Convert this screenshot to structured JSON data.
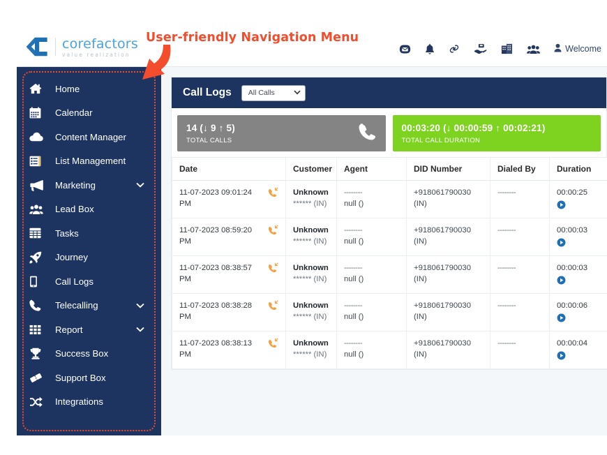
{
  "annotation": {
    "text": "User-friendly Navigation Menu",
    "color": "#f44d2e",
    "arrow_icon": "curved-arrow-icon"
  },
  "brand": {
    "logo_icon": "corefactors-logo-icon",
    "name": "corefactors",
    "tagline": "value realization",
    "name_color": "#4aa3dd"
  },
  "topbar": {
    "icons": [
      {
        "name": "message-icon",
        "glyph": "✉"
      },
      {
        "name": "bell-icon",
        "glyph": "🔔"
      },
      {
        "name": "link-icon",
        "glyph": "🔗"
      },
      {
        "name": "handshake-support-icon",
        "glyph": "✋"
      },
      {
        "name": "building-icon",
        "glyph": "🏢"
      },
      {
        "name": "users-group-icon",
        "glyph": "👥"
      }
    ],
    "user": {
      "icon": "user-icon",
      "label": "Welcome"
    }
  },
  "sidebar": {
    "background": "#1d3461",
    "highlight_border": "#f04a28",
    "items": [
      {
        "icon": "home-icon",
        "label": "Home",
        "expandable": false
      },
      {
        "icon": "calendar-icon",
        "label": "Calendar",
        "expandable": false
      },
      {
        "icon": "cloud-icon",
        "label": "Content Manager",
        "expandable": false
      },
      {
        "icon": "list-icon",
        "label": "List Management",
        "expandable": false
      },
      {
        "icon": "megaphone-icon",
        "label": "Marketing",
        "expandable": true
      },
      {
        "icon": "people-icon",
        "label": "Lead Box",
        "expandable": false
      },
      {
        "icon": "table-grid-icon",
        "label": "Tasks",
        "expandable": false
      },
      {
        "icon": "rocket-icon",
        "label": "Journey",
        "expandable": false
      },
      {
        "icon": "mobile-phone-icon",
        "label": "Call Logs",
        "expandable": false
      },
      {
        "icon": "phone-icon",
        "label": "Telecalling",
        "expandable": true
      },
      {
        "icon": "grid-dots-icon",
        "label": "Report",
        "expandable": true
      },
      {
        "icon": "trophy-icon",
        "label": "Success Box",
        "expandable": false
      },
      {
        "icon": "ticket-icon",
        "label": "Support Box",
        "expandable": false
      },
      {
        "icon": "shuffle-icon",
        "label": "Integrations",
        "expandable": false
      }
    ]
  },
  "main": {
    "panel_title": "Call Logs",
    "filter": {
      "value": "All Calls",
      "icon": "chevron-down-icon"
    },
    "stats": [
      {
        "value": "14 (↓ 9 ↑ 5)",
        "label": "TOTAL CALLS",
        "color": "#848484",
        "icon": "phone-icon"
      },
      {
        "value": "00:03:20 (↓ 00:00:59 ↑ 00:02:21)",
        "label": "TOTAL CALL DURATION",
        "color": "#7ed321",
        "icon": ""
      }
    ],
    "table": {
      "columns": [
        "Date",
        "Customer",
        "Agent",
        "DID Number",
        "Dialed By",
        "Duration"
      ],
      "rows": [
        {
          "date": "11-07-2023 09:01:24 PM",
          "direction_icon": "incoming-call-icon",
          "customer_name": "Unknown",
          "customer_sub": "****** (IN)",
          "agent_name": "--------",
          "agent_sub": "null ()",
          "did_number": "+918061790030",
          "did_sub": "(IN)",
          "dialed_by": "--------",
          "duration": "00:00:25",
          "play_icon": "play-icon"
        },
        {
          "date": "11-07-2023 08:59:20 PM",
          "direction_icon": "incoming-call-icon",
          "customer_name": "Unknown",
          "customer_sub": "****** (IN)",
          "agent_name": "--------",
          "agent_sub": "null ()",
          "did_number": "+918061790030",
          "did_sub": "(IN)",
          "dialed_by": "--------",
          "duration": "00:00:03",
          "play_icon": "play-icon"
        },
        {
          "date": "11-07-2023 08:38:57 PM",
          "direction_icon": "incoming-call-icon",
          "customer_name": "Unknown",
          "customer_sub": "****** (IN)",
          "agent_name": "--------",
          "agent_sub": "null ()",
          "did_number": "+918061790030",
          "did_sub": "(IN)",
          "dialed_by": "--------",
          "duration": "00:00:03",
          "play_icon": "play-icon"
        },
        {
          "date": "11-07-2023 08:38:28 PM",
          "direction_icon": "incoming-call-icon",
          "customer_name": "Unknown",
          "customer_sub": "****** (IN)",
          "agent_name": "--------",
          "agent_sub": "null ()",
          "did_number": "+918061790030",
          "did_sub": "(IN)",
          "dialed_by": "--------",
          "duration": "00:00:06",
          "play_icon": "play-icon"
        },
        {
          "date": "11-07-2023 08:38:13 PM",
          "direction_icon": "incoming-call-icon",
          "customer_name": "Unknown",
          "customer_sub": "****** (IN)",
          "agent_name": "--------",
          "agent_sub": "null ()",
          "did_number": "+918061790030",
          "did_sub": "(IN)",
          "dialed_by": "--------",
          "duration": "00:00:04",
          "play_icon": "play-icon"
        }
      ]
    }
  }
}
